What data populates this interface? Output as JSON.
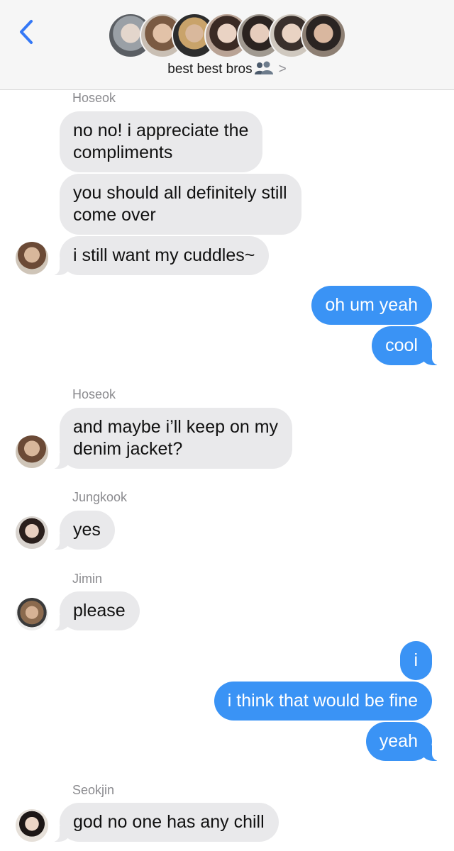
{
  "header": {
    "back_icon": "chevron-left-icon",
    "group_name": "best best bros",
    "group_icon": "people-icon",
    "chevron": ">",
    "accent_color": "#3478f6",
    "member_avatar_count": 7
  },
  "messages": {
    "incoming_color": "#e9e9eb",
    "outgoing_color": "#3a93f5",
    "sender_hoseok_1": "Hoseok",
    "hoseok_1_a": "no no! i appreciate the",
    "hoseok_1_a2": "compliments",
    "hoseok_1_b": "you should all definitely still",
    "hoseok_1_b2": "come over",
    "hoseok_1_c": "i still want my cuddles~",
    "me_1_a": "oh um yeah",
    "me_1_b": "cool",
    "sender_hoseok_2": "Hoseok",
    "hoseok_2_a": "and maybe i’ll keep on my",
    "hoseok_2_a2": "denim jacket?",
    "sender_jungkook": "Jungkook",
    "jungkook_a": "yes",
    "sender_jimin": "Jimin",
    "jimin_a": "please",
    "me_2_a": "i",
    "me_2_b": "i think that would be fine",
    "me_2_c": "yeah",
    "sender_seokjin": "Seokjin",
    "seokjin_a": "god no one has any chill"
  }
}
